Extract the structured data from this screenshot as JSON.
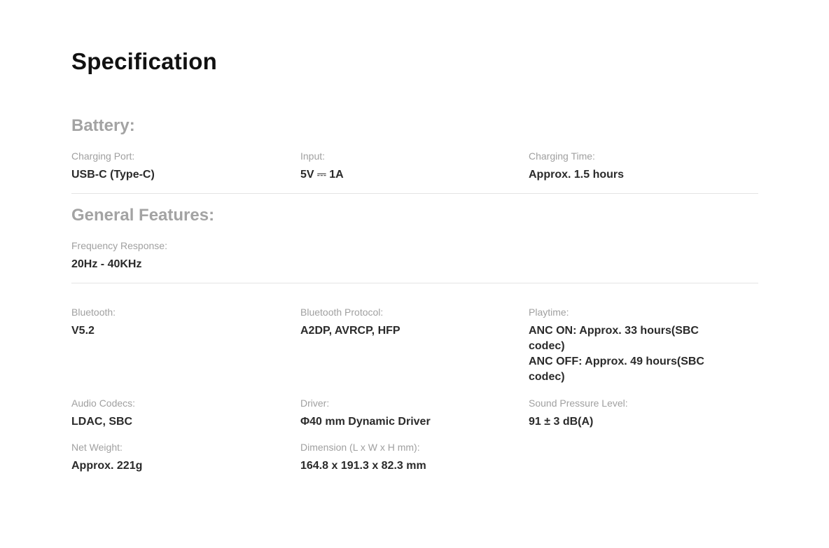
{
  "page_title": "Specification",
  "battery": {
    "title": "Battery:",
    "specs": [
      {
        "label": "Charging Port:",
        "value": "USB-C (Type-C)"
      },
      {
        "label": "Input:",
        "value": "5V ⎓ 1A"
      },
      {
        "label": "Charging Time:",
        "value": "Approx. 1.5 hours"
      }
    ]
  },
  "general": {
    "title": "General Features:",
    "specs": [
      {
        "label": "Frequency Response:",
        "value": "20Hz - 40KHz"
      }
    ]
  },
  "details": {
    "specs": [
      {
        "label": "Bluetooth:",
        "value": "V5.2"
      },
      {
        "label": "Bluetooth Protocol:",
        "value": "A2DP, AVRCP, HFP"
      },
      {
        "label": "Playtime:",
        "value_lines": [
          "ANC ON: Approx. 33 hours(SBC codec)",
          "ANC OFF: Approx. 49 hours(SBC codec)"
        ]
      },
      {
        "label": "Audio Codecs:",
        "value": "LDAC, SBC"
      },
      {
        "label": "Driver:",
        "value": "Φ40 mm Dynamic Driver"
      },
      {
        "label": "Sound Pressure Level:",
        "value": "91 ± 3 dB(A)"
      },
      {
        "label": "Net Weight:",
        "value": "Approx. 221g"
      },
      {
        "label": "Dimension (L x W x H mm):",
        "value": "164.8 x 191.3 x 82.3 mm"
      }
    ]
  }
}
